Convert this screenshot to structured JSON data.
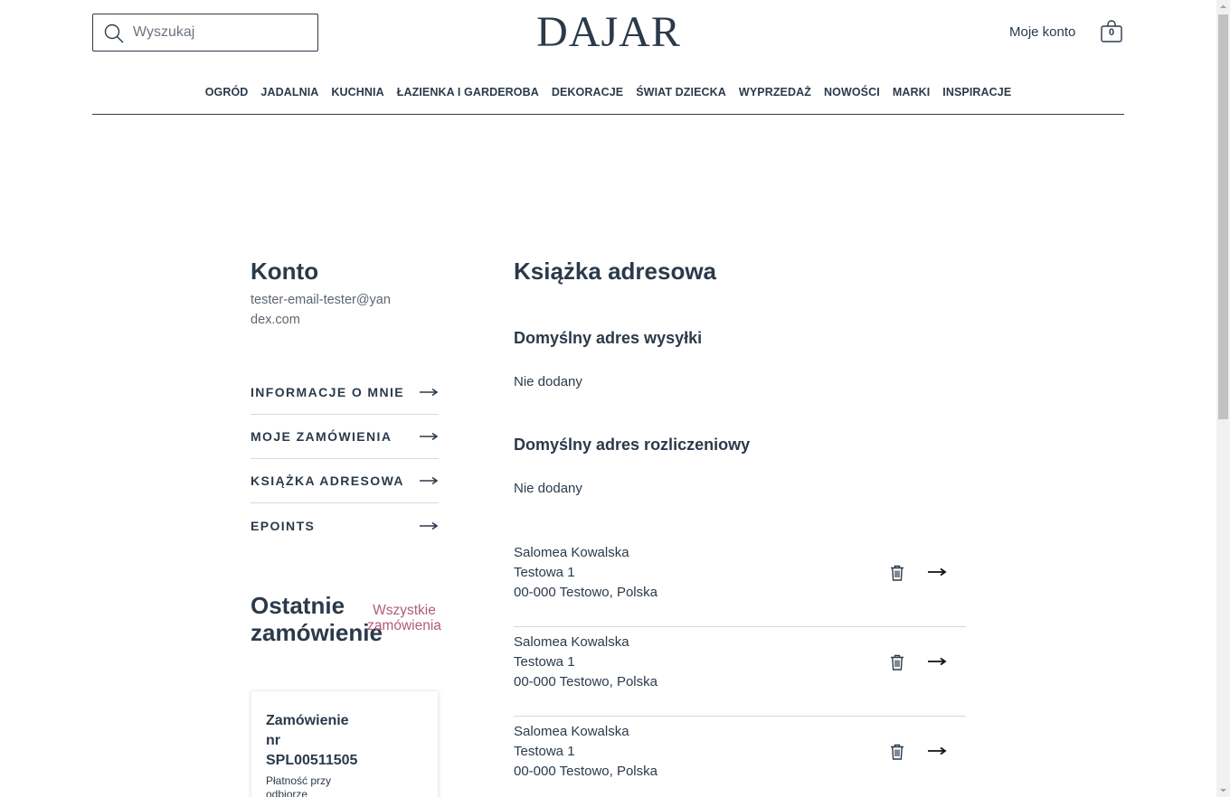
{
  "header": {
    "search_placeholder": "Wyszukaj",
    "logo": "DAJAR",
    "account_link": "Moje konto",
    "cart_count": "0"
  },
  "nav": {
    "items": [
      {
        "label": "OGRÓD"
      },
      {
        "label": "JADALNIA"
      },
      {
        "label": "KUCHNIA"
      },
      {
        "label": "ŁAZIENKA I GARDEROBA"
      },
      {
        "label": "DEKORACJE"
      },
      {
        "label": "ŚWIAT DZIECKA"
      },
      {
        "label": "WYPRZEDAŻ"
      },
      {
        "label": "NOWOŚCI"
      },
      {
        "label": "MARKI"
      },
      {
        "label": "INSPIRACJE"
      }
    ]
  },
  "sidebar": {
    "title": "Konto",
    "email": "tester-email-tester@yandex.com",
    "menu": [
      {
        "label": "INFORMACJE O MNIE"
      },
      {
        "label": "MOJE ZAMÓWIENIA"
      },
      {
        "label": "KSIĄŻKA ADRESOWA"
      },
      {
        "label": "EPOINTS"
      }
    ],
    "recent_title": "Ostatnie zamówienie",
    "recent_all_link": "Wszystkie zamówienia",
    "order": {
      "title": "Zamówienie nr SPL00511505",
      "payment": "Płatność przy odbiorze"
    }
  },
  "main": {
    "title": "Książka adresowa",
    "shipping_heading": "Domyślny adres wysyłki",
    "shipping_value": "Nie dodany",
    "billing_heading": "Domyślny adres rozliczeniowy",
    "billing_value": "Nie dodany",
    "addresses": [
      {
        "name": "Salomea Kowalska",
        "street": "Testowa 1",
        "city": "00-000 Testowo, Polska"
      },
      {
        "name": "Salomea Kowalska",
        "street": "Testowa 1",
        "city": "00-000 Testowo, Polska"
      },
      {
        "name": "Salomea Kowalska",
        "street": "Testowa 1",
        "city": "00-000 Testowo, Polska"
      }
    ]
  },
  "colors": {
    "text": "#2b3a4a",
    "accent_link": "#b05b7d",
    "divider": "#d6d9dc"
  },
  "icons": {
    "search": "search-icon",
    "cart": "shopping-bag-icon",
    "arrow": "arrow-right-icon",
    "trash": "trash-icon"
  }
}
